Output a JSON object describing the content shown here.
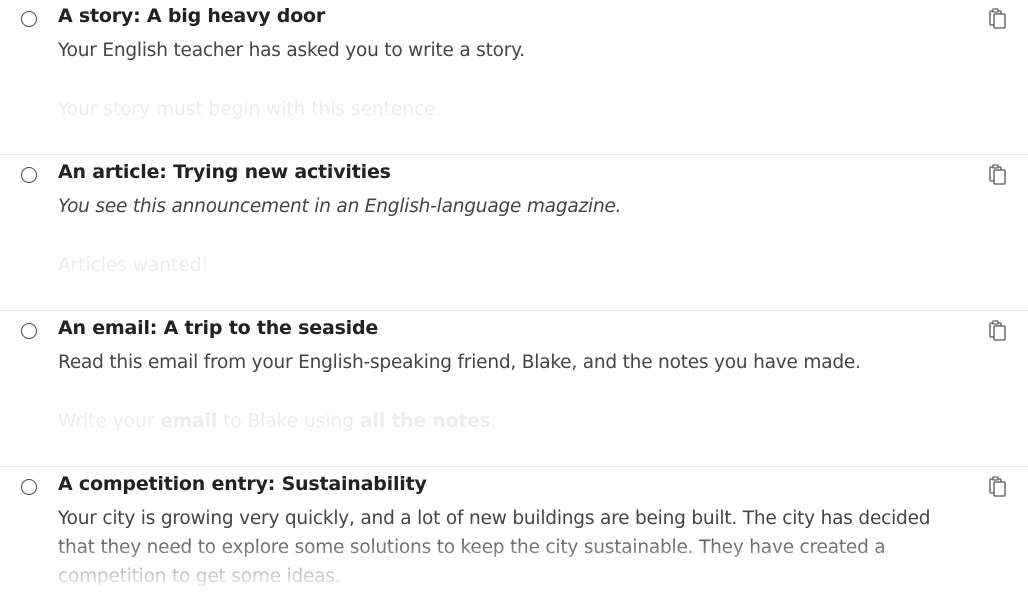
{
  "tasks": [
    {
      "title": "A story: A big heavy door",
      "description": "Your English teacher has asked you to write a story.",
      "description_italic": false,
      "preview": "Your story must begin with this sentence."
    },
    {
      "title": "An article: Trying new activities",
      "description": "You see this announcement in an English-language magazine.",
      "description_italic": true,
      "preview": "Articles wanted!"
    },
    {
      "title": "An email: A trip to the seaside",
      "description": "Read this email from your English-speaking friend, Blake, and the notes you have made.",
      "description_italic": false,
      "preview_parts": [
        "Write your ",
        "email",
        " to Blake using ",
        "all the notes",
        "."
      ]
    },
    {
      "title": "A competition entry: Sustainability",
      "description": "Your city is growing very quickly, and a lot of new buildings are being built. The city has de­cided that they need to explore some solutions to keep the city sustainable. They have cre­ated a competition to get some ideas."
    }
  ],
  "icons": {
    "radio": "radio-button-unchecked",
    "copy": "copy-icon"
  }
}
